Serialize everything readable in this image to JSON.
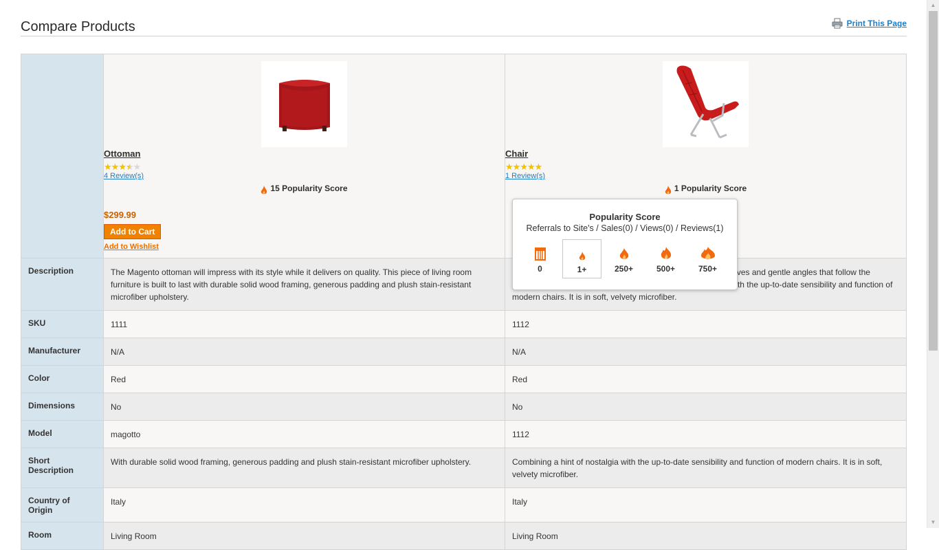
{
  "header": {
    "title": "Compare Products",
    "print_label": "Print This Page"
  },
  "products": [
    {
      "name": "Ottoman",
      "rating_stars": 3.5,
      "reviews": "4 Review(s)",
      "popularity": "15 Popularity Score",
      "price": "$299.99",
      "add_to_cart": "Add to Cart",
      "add_to_wishlist": "Add to Wishlist",
      "image_color": "#b51a1a"
    },
    {
      "name": "Chair",
      "rating_stars": 5,
      "reviews": "1 Review(s)",
      "popularity": "1 Popularity Score",
      "image_color": "#c81b1b"
    }
  ],
  "popup": {
    "title": "Popularity Score",
    "subtitle": "Referrals to Site's / Sales(0) / Views(0) / Reviews(1)",
    "tiers": [
      "0",
      "1+",
      "250+",
      "500+",
      "750+"
    ],
    "selected_tier": "1+"
  },
  "attributes": [
    {
      "label": "Description",
      "values": [
        "The Magento ottoman will impress with its style while it delivers on quality. This piece of living room furniture is built to last with durable solid wood framing, generous padding and plush stain-resistant microfiber upholstery.",
        "The Magento chair is designed with curved lines, rounded curves and gentle angles that follow the contours of the human body. It combines a hint of nostalgia with the up-to-date sensibility and function of modern chairs. It is in soft, velvety microfiber."
      ]
    },
    {
      "label": "SKU",
      "values": [
        "1111",
        "1112"
      ]
    },
    {
      "label": "Manufacturer",
      "values": [
        "N/A",
        "N/A"
      ]
    },
    {
      "label": "Color",
      "values": [
        "Red",
        "Red"
      ]
    },
    {
      "label": "Dimensions",
      "values": [
        "No",
        "No"
      ]
    },
    {
      "label": "Model",
      "values": [
        "magotto",
        "1112"
      ]
    },
    {
      "label": "Short Description",
      "values": [
        "With durable solid wood framing, generous padding and plush stain-resistant microfiber upholstery.",
        "Combining a hint of nostalgia with the up-to-date sensibility and function of modern chairs. It is in soft, velvety microfiber."
      ]
    },
    {
      "label": "Country of Origin",
      "values": [
        "Italy",
        "Italy"
      ]
    },
    {
      "label": "Room",
      "values": [
        "Living Room",
        "Living Room"
      ]
    }
  ],
  "colors": {
    "label_bg": "#d6e4ee",
    "price": "#c76200",
    "button": "#f18200",
    "link": "#1e7ec8",
    "flame": "#f06a0f"
  }
}
